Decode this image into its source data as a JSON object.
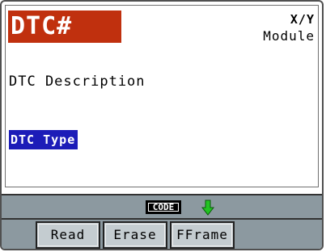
{
  "header": {
    "dtc_code": "DTC#",
    "xy_label": "X/Y",
    "module_label": "Module"
  },
  "body": {
    "description": "DTC Description",
    "dtc_type": "DTC Type"
  },
  "indicator": {
    "code_icon_label": "CODE",
    "arrow_icon": "down-arrow-icon",
    "arrow_color": "#22c322"
  },
  "softkeys": {
    "read": "Read",
    "erase": "Erase",
    "fframe": "FFrame"
  },
  "colors": {
    "dtc_banner": "#c0300e",
    "type_highlight": "#1c1cb8",
    "bar_background": "#8c99a0"
  }
}
